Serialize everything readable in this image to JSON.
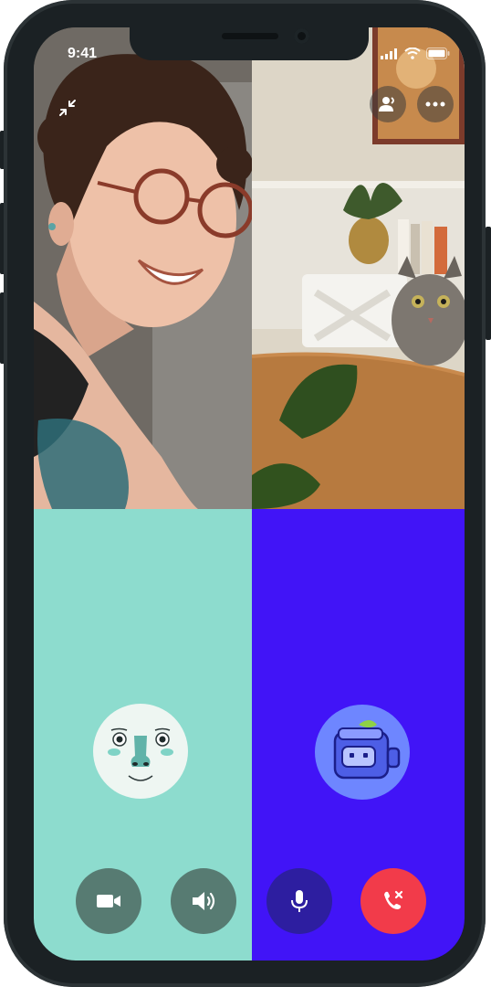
{
  "status_bar": {
    "time": "9:41"
  },
  "tiles": [
    {
      "name": "participant-woman-video",
      "kind": "video"
    },
    {
      "name": "participant-cat-video",
      "kind": "video"
    },
    {
      "name": "participant-face-avatar",
      "kind": "avatar",
      "color": "#8ddcce"
    },
    {
      "name": "participant-robot-avatar",
      "kind": "avatar",
      "color": "#4114f7"
    }
  ],
  "controls": {
    "video_icon": "video-camera-icon",
    "speaker_icon": "speaker-icon",
    "mic_icon": "microphone-icon",
    "end_call_icon": "end-call-icon",
    "colors": {
      "video": "#577b72",
      "speaker": "#577b72",
      "mic": "#2d1ea0",
      "end": "#f23b4a"
    }
  },
  "overlay": {
    "minimize_icon": "minimize-icon",
    "participants_icon": "participants-icon",
    "more_icon": "more-icon"
  }
}
